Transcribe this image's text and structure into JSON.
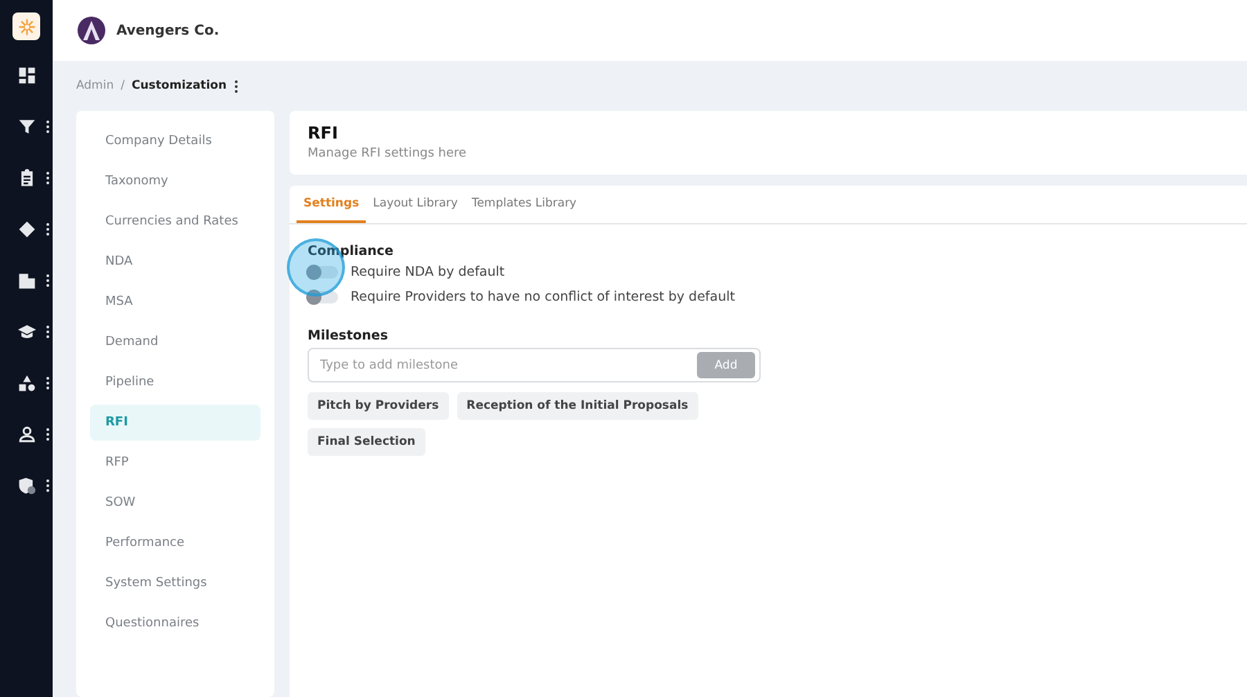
{
  "company": {
    "name": "Avengers Co."
  },
  "rail": [
    {
      "kind": "dashboard",
      "has_menu": false
    },
    {
      "kind": "filter",
      "has_menu": true
    },
    {
      "kind": "clipboard",
      "has_menu": true
    },
    {
      "kind": "tag",
      "has_menu": true
    },
    {
      "kind": "building",
      "has_menu": true
    },
    {
      "kind": "graduation",
      "has_menu": true
    },
    {
      "kind": "shapes",
      "has_menu": true
    },
    {
      "kind": "user",
      "has_menu": true
    },
    {
      "kind": "shield",
      "has_menu": true
    }
  ],
  "breadcrumb": {
    "parent": "Admin",
    "separator": "/",
    "current": "Customization"
  },
  "sidebar": {
    "items": [
      {
        "label": "Company Details",
        "selected": false
      },
      {
        "label": "Taxonomy",
        "selected": false
      },
      {
        "label": "Currencies and Rates",
        "selected": false
      },
      {
        "label": "NDA",
        "selected": false
      },
      {
        "label": "MSA",
        "selected": false
      },
      {
        "label": "Demand",
        "selected": false
      },
      {
        "label": "Pipeline",
        "selected": false
      },
      {
        "label": "RFI",
        "selected": true
      },
      {
        "label": "RFP",
        "selected": false
      },
      {
        "label": "SOW",
        "selected": false
      },
      {
        "label": "Performance",
        "selected": false
      },
      {
        "label": "System Settings",
        "selected": false
      },
      {
        "label": "Questionnaires",
        "selected": false
      }
    ]
  },
  "page": {
    "title": "RFI",
    "subtitle": "Manage RFI settings here"
  },
  "tabs": [
    {
      "label": "Settings",
      "selected": true
    },
    {
      "label": "Layout Library",
      "selected": false
    },
    {
      "label": "Templates Library",
      "selected": false
    }
  ],
  "compliance": {
    "heading": "Compliance",
    "options": [
      {
        "label": "Require NDA by default",
        "on": false
      },
      {
        "label": "Require Providers to have no conflict of interest by default",
        "on": false
      }
    ]
  },
  "milestones": {
    "heading": "Milestones",
    "input": {
      "placeholder": "Type to add milestone"
    },
    "add_button": {
      "label": "Add",
      "disabled": true
    },
    "chips": [
      "Pitch by Providers",
      "Reception of the Initial Proposals",
      "Final Selection"
    ]
  },
  "click_indicator": {
    "shown": true
  }
}
